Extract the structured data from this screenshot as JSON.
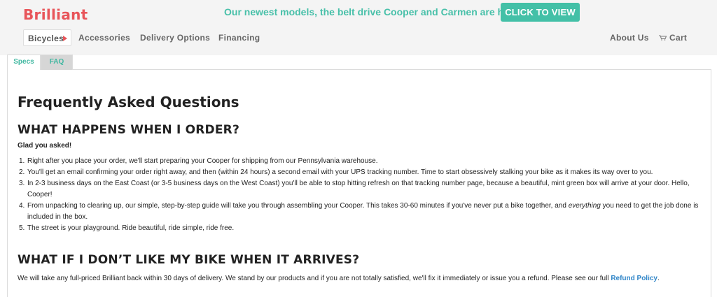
{
  "brand": {
    "logo": "Brilliant",
    "accent_color": "#e8555a",
    "teal_color": "#43c0a7"
  },
  "promo": {
    "text": "Our newest models, the belt drive Cooper and Carmen are here!.",
    "button": "CLICK TO VIEW"
  },
  "nav": {
    "items": [
      "Bicycles",
      "Accessories",
      "Delivery Options",
      "Financing"
    ],
    "about": "About Us",
    "cart": "Cart"
  },
  "tabs": {
    "specs": "Specs",
    "faq": "FAQ"
  },
  "faq": {
    "title": "Frequently Asked Questions",
    "section1": {
      "heading": "WHAT HAPPENS WHEN I ORDER?",
      "intro": "Glad you asked!",
      "items": [
        {
          "num": "1.",
          "text": "Right after you place your order, we'll start preparing your Cooper for shipping from our Pennsylvania warehouse."
        },
        {
          "num": "2.",
          "text": "You'll get an email confirming your order right away, and then (within 24 hours) a second email with your UPS tracking number. Time to start obsessively stalking your bike as it makes its way over to you."
        },
        {
          "num": "3.",
          "text": "In 2-3 business days on the East Coast (or 3-5 business days on the West Coast) you'll be able to stop hitting refresh on that tracking number page, because a beautiful, mint green box will arrive at your door. Hello, Cooper!"
        },
        {
          "num": "4.",
          "text_a": "From unpacking to clearing up, our simple, step-by-step guide will take you through assembling your Cooper. This takes 30-60 minutes if you've never put a bike together, and ",
          "text_em": "everything",
          "text_b": " you need to get the job done is included in the box."
        },
        {
          "num": "5.",
          "text": "The street is your playground. Ride beautiful, ride simple, ride free."
        }
      ]
    },
    "section2": {
      "heading": "WHAT IF I DON’T LIKE MY BIKE WHEN IT ARRIVES?",
      "text": "We will take any full-priced Brilliant back within 30 days of delivery. We stand by our products and if you are not totally satisfied, we'll fix it immediately or issue you a refund. Please see our full ",
      "link": "Refund Policy",
      "end": "."
    }
  }
}
